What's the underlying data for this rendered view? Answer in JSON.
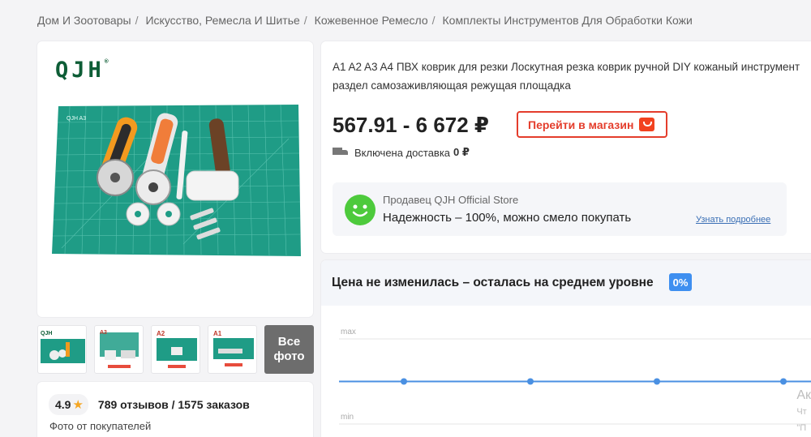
{
  "breadcrumb": {
    "items": [
      "Дом И Зоотовары",
      "Искусство, Ремесла И Шитье",
      "Кожевенное Ремесло",
      "Комплекты Инструментов Для Обработки Кожи"
    ],
    "separator": "/"
  },
  "gallery": {
    "logo_text": "QJH",
    "logo_reg": "®",
    "mat_text": "QJH A3",
    "thumb_labels": [
      "QJH",
      "A3",
      "A2",
      "A1"
    ],
    "all_photos_line1": "Все",
    "all_photos_line2": "фото"
  },
  "rating": {
    "score": "4.9",
    "star_icon": "star-icon",
    "summary": "789 отзывов / 1575 заказов",
    "buyer_photos": "Фото от покупателей"
  },
  "product": {
    "title": "A1 A2 A3 A4 ПВХ коврик для резки Лоскутная резка коврик ручной DIY кожаный инструмент раздел самозаживляющая режущая площадка",
    "price": "567.91 - 6 672 ₽",
    "shop_button": "Перейти в магазин",
    "delivery_label": "Включена доставка",
    "delivery_value": "0 ₽"
  },
  "seller": {
    "name": "Продавец QJH Official Store",
    "reliability": "Надежность – 100%, можно смело покупать",
    "more_link": "Узнать подробнее"
  },
  "price_history": {
    "title": "Цена не изменилась – осталась на среднем уровне",
    "change_badge": "0%",
    "max_label": "max",
    "min_label": "min"
  },
  "chart_data": {
    "type": "line",
    "title": "Цена не изменилась – осталась на среднем уровне",
    "series": [
      {
        "values": [
          0.5,
          0.5,
          0.5,
          0.5
        ]
      }
    ],
    "grid": true
  },
  "overlay": {
    "line1": "Ак",
    "line2": "Чт",
    "line3": "\"П"
  },
  "colors": {
    "accent_red": "#e43d2c",
    "seller_green": "#4dca3c",
    "chart_blue": "#4a90e2",
    "badge_blue": "#3e8ff0"
  }
}
